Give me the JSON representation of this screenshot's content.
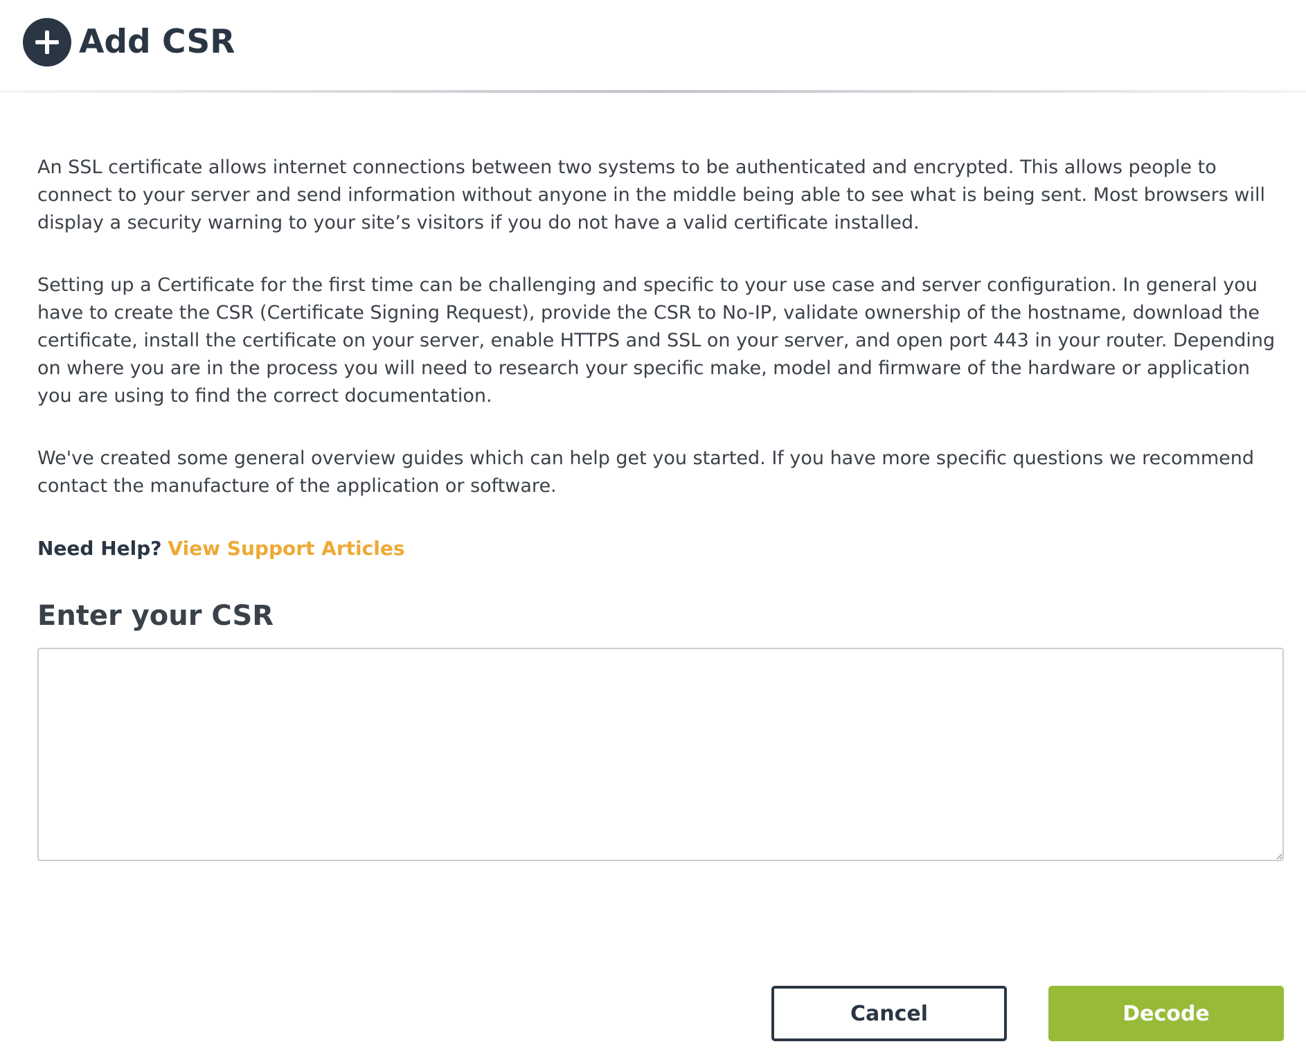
{
  "header": {
    "icon": "plus-circle-icon",
    "title": "Add CSR"
  },
  "intro": {
    "paragraphs": [
      "An SSL certificate allows internet connections between two systems to be authenticated and encrypted. This allows people to connect to your server and send information without anyone in the middle being able to see what is being sent. Most browsers will display a security warning to your site’s visitors if you do not have a valid certificate installed.",
      "Setting up a Certificate for the first time can be challenging and specific to your use case and server configuration. In general you have to create the CSR (Certificate Signing Request), provide the CSR to No-IP, validate ownership of the hostname, download the certificate, install the certificate on your server, enable HTTPS and SSL on your server, and open port 443 in your router. Depending on where you are in the process you will need to research your specific make, model and firmware of the hardware or application you are using to find the correct documentation.",
      "We've created some general overview guides which can help get you started. If you have more specific questions we recommend contact the manufacture of the application or software."
    ]
  },
  "help": {
    "label": "Need Help?",
    "link_text": "View Support Articles"
  },
  "csr_form": {
    "section_title": "Enter your CSR",
    "input_value": ""
  },
  "actions": {
    "cancel_label": "Cancel",
    "decode_label": "Decode"
  },
  "colors": {
    "header_dark": "#2b3644",
    "link_orange": "#edaa35",
    "decode_green": "#97bb39",
    "body_text": "#3b4149"
  }
}
